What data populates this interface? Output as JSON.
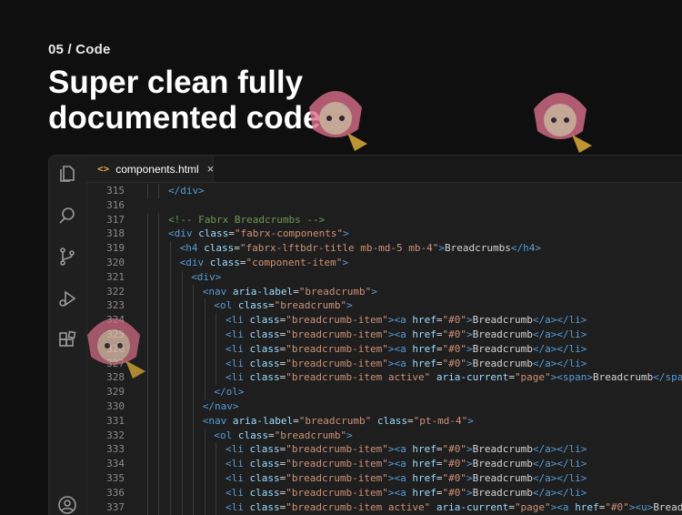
{
  "section": {
    "eyebrow": "05 / Code",
    "title_line1": "Super clean fully",
    "title_line2": "documented code"
  },
  "tab": {
    "icon": "<>",
    "name": "components.html",
    "close": "×"
  },
  "colors": {
    "tag": "#569cd6",
    "attr": "#9cdcfe",
    "string": "#ce9178",
    "text": "#d4d4d4",
    "comment": "#6a9955",
    "line_number": "#8a8a8a"
  },
  "activity_icons": [
    "files-icon",
    "search-icon",
    "source-control-icon",
    "run-debug-icon",
    "extensions-icon",
    "account-icon"
  ],
  "code": [
    {
      "n": "315",
      "indent": 2,
      "tokens": [
        [
          "tag",
          "</div>"
        ]
      ]
    },
    {
      "n": "316",
      "indent": 0,
      "tokens": []
    },
    {
      "n": "317",
      "indent": 2,
      "tokens": [
        [
          "com",
          "<!-- Fabrx Breadcrumbs -->"
        ]
      ]
    },
    {
      "n": "318",
      "indent": 2,
      "tokens": [
        [
          "tag",
          "<div "
        ],
        [
          "attr",
          "class"
        ],
        [
          "txt",
          "="
        ],
        [
          "str",
          "\"fabrx-components\""
        ],
        [
          "tag",
          ">"
        ]
      ]
    },
    {
      "n": "319",
      "indent": 3,
      "tokens": [
        [
          "tag",
          "<h4 "
        ],
        [
          "attr",
          "class"
        ],
        [
          "txt",
          "="
        ],
        [
          "str",
          "\"fabrx-lftbdr-title mb-md-5 mb-4\""
        ],
        [
          "tag",
          ">"
        ],
        [
          "txt",
          "Breadcrumbs"
        ],
        [
          "tag",
          "</h4>"
        ]
      ]
    },
    {
      "n": "320",
      "indent": 3,
      "tokens": [
        [
          "tag",
          "<div "
        ],
        [
          "attr",
          "class"
        ],
        [
          "txt",
          "="
        ],
        [
          "str",
          "\"component-item\""
        ],
        [
          "tag",
          ">"
        ]
      ]
    },
    {
      "n": "321",
      "indent": 4,
      "tokens": [
        [
          "tag",
          "<div>"
        ]
      ]
    },
    {
      "n": "322",
      "indent": 5,
      "tokens": [
        [
          "tag",
          "<nav "
        ],
        [
          "attr",
          "aria-label"
        ],
        [
          "txt",
          "="
        ],
        [
          "str",
          "\"breadcrumb\""
        ],
        [
          "tag",
          ">"
        ]
      ]
    },
    {
      "n": "323",
      "indent": 6,
      "tokens": [
        [
          "tag",
          "<ol "
        ],
        [
          "attr",
          "class"
        ],
        [
          "txt",
          "="
        ],
        [
          "str",
          "\"breadcrumb\""
        ],
        [
          "tag",
          ">"
        ]
      ]
    },
    {
      "n": "324",
      "indent": 7,
      "tokens": [
        [
          "tag",
          "<li "
        ],
        [
          "attr",
          "class"
        ],
        [
          "txt",
          "="
        ],
        [
          "str",
          "\"breadcrumb-item\""
        ],
        [
          "tag",
          "><a "
        ],
        [
          "attr",
          "href"
        ],
        [
          "txt",
          "="
        ],
        [
          "str",
          "\"#0\""
        ],
        [
          "tag",
          ">"
        ],
        [
          "txt",
          "Breadcrumb"
        ],
        [
          "tag",
          "</a></li>"
        ]
      ]
    },
    {
      "n": "325",
      "indent": 7,
      "tokens": [
        [
          "tag",
          "<li "
        ],
        [
          "attr",
          "class"
        ],
        [
          "txt",
          "="
        ],
        [
          "str",
          "\"breadcrumb-item\""
        ],
        [
          "tag",
          "><a "
        ],
        [
          "attr",
          "href"
        ],
        [
          "txt",
          "="
        ],
        [
          "str",
          "\"#0\""
        ],
        [
          "tag",
          ">"
        ],
        [
          "txt",
          "Breadcrumb"
        ],
        [
          "tag",
          "</a></li>"
        ]
      ]
    },
    {
      "n": "326",
      "indent": 7,
      "tokens": [
        [
          "tag",
          "<li "
        ],
        [
          "attr",
          "class"
        ],
        [
          "txt",
          "="
        ],
        [
          "str",
          "\"breadcrumb-item\""
        ],
        [
          "tag",
          "><a "
        ],
        [
          "attr",
          "href"
        ],
        [
          "txt",
          "="
        ],
        [
          "str",
          "\"#0\""
        ],
        [
          "tag",
          ">"
        ],
        [
          "txt",
          "Breadcrumb"
        ],
        [
          "tag",
          "</a></li>"
        ]
      ]
    },
    {
      "n": "327",
      "indent": 7,
      "tokens": [
        [
          "tag",
          "<li "
        ],
        [
          "attr",
          "class"
        ],
        [
          "txt",
          "="
        ],
        [
          "str",
          "\"breadcrumb-item\""
        ],
        [
          "tag",
          "><a "
        ],
        [
          "attr",
          "href"
        ],
        [
          "txt",
          "="
        ],
        [
          "str",
          "\"#0\""
        ],
        [
          "tag",
          ">"
        ],
        [
          "txt",
          "Breadcrumb"
        ],
        [
          "tag",
          "</a></li>"
        ]
      ]
    },
    {
      "n": "328",
      "indent": 7,
      "tokens": [
        [
          "tag",
          "<li "
        ],
        [
          "attr",
          "class"
        ],
        [
          "txt",
          "="
        ],
        [
          "str",
          "\"breadcrumb-item active\""
        ],
        [
          "txt",
          " "
        ],
        [
          "attr",
          "aria-current"
        ],
        [
          "txt",
          "="
        ],
        [
          "str",
          "\"page\""
        ],
        [
          "tag",
          "><span>"
        ],
        [
          "txt",
          "Breadcrumb"
        ],
        [
          "tag",
          "</span></li>"
        ]
      ]
    },
    {
      "n": "329",
      "indent": 6,
      "tokens": [
        [
          "tag",
          "</ol>"
        ]
      ]
    },
    {
      "n": "330",
      "indent": 5,
      "tokens": [
        [
          "tag",
          "</nav>"
        ]
      ]
    },
    {
      "n": "331",
      "indent": 5,
      "tokens": [
        [
          "tag",
          "<nav "
        ],
        [
          "attr",
          "aria-label"
        ],
        [
          "txt",
          "="
        ],
        [
          "str",
          "\"breadcrumb\""
        ],
        [
          "txt",
          " "
        ],
        [
          "attr",
          "class"
        ],
        [
          "txt",
          "="
        ],
        [
          "str",
          "\"pt-md-4\""
        ],
        [
          "tag",
          ">"
        ]
      ]
    },
    {
      "n": "332",
      "indent": 6,
      "tokens": [
        [
          "tag",
          "<ol "
        ],
        [
          "attr",
          "class"
        ],
        [
          "txt",
          "="
        ],
        [
          "str",
          "\"breadcrumb\""
        ],
        [
          "tag",
          ">"
        ]
      ]
    },
    {
      "n": "333",
      "indent": 7,
      "tokens": [
        [
          "tag",
          "<li "
        ],
        [
          "attr",
          "class"
        ],
        [
          "txt",
          "="
        ],
        [
          "str",
          "\"breadcrumb-item\""
        ],
        [
          "tag",
          "><a "
        ],
        [
          "attr",
          "href"
        ],
        [
          "txt",
          "="
        ],
        [
          "str",
          "\"#0\""
        ],
        [
          "tag",
          ">"
        ],
        [
          "txt",
          "Breadcrumb"
        ],
        [
          "tag",
          "</a></li>"
        ]
      ]
    },
    {
      "n": "334",
      "indent": 7,
      "tokens": [
        [
          "tag",
          "<li "
        ],
        [
          "attr",
          "class"
        ],
        [
          "txt",
          "="
        ],
        [
          "str",
          "\"breadcrumb-item\""
        ],
        [
          "tag",
          "><a "
        ],
        [
          "attr",
          "href"
        ],
        [
          "txt",
          "="
        ],
        [
          "str",
          "\"#0\""
        ],
        [
          "tag",
          ">"
        ],
        [
          "txt",
          "Breadcrumb"
        ],
        [
          "tag",
          "</a></li>"
        ]
      ]
    },
    {
      "n": "335",
      "indent": 7,
      "tokens": [
        [
          "tag",
          "<li "
        ],
        [
          "attr",
          "class"
        ],
        [
          "txt",
          "="
        ],
        [
          "str",
          "\"breadcrumb-item\""
        ],
        [
          "tag",
          "><a "
        ],
        [
          "attr",
          "href"
        ],
        [
          "txt",
          "="
        ],
        [
          "str",
          "\"#0\""
        ],
        [
          "tag",
          ">"
        ],
        [
          "txt",
          "Breadcrumb"
        ],
        [
          "tag",
          "</a></li>"
        ]
      ]
    },
    {
      "n": "336",
      "indent": 7,
      "tokens": [
        [
          "tag",
          "<li "
        ],
        [
          "attr",
          "class"
        ],
        [
          "txt",
          "="
        ],
        [
          "str",
          "\"breadcrumb-item\""
        ],
        [
          "tag",
          "><a "
        ],
        [
          "attr",
          "href"
        ],
        [
          "txt",
          "="
        ],
        [
          "str",
          "\"#0\""
        ],
        [
          "tag",
          ">"
        ],
        [
          "txt",
          "Breadcrumb"
        ],
        [
          "tag",
          "</a></li>"
        ]
      ]
    },
    {
      "n": "337",
      "indent": 7,
      "tokens": [
        [
          "tag",
          "<li "
        ],
        [
          "attr",
          "class"
        ],
        [
          "txt",
          "="
        ],
        [
          "str",
          "\"breadcrumb-item active\""
        ],
        [
          "txt",
          " "
        ],
        [
          "attr",
          "aria-current"
        ],
        [
          "txt",
          "="
        ],
        [
          "str",
          "\"page\""
        ],
        [
          "tag",
          "><a "
        ],
        [
          "attr",
          "href"
        ],
        [
          "txt",
          "="
        ],
        [
          "str",
          "\"#0\""
        ],
        [
          "tag",
          "><u>"
        ],
        [
          "txt",
          "Breadcrumb"
        ]
      ]
    }
  ]
}
